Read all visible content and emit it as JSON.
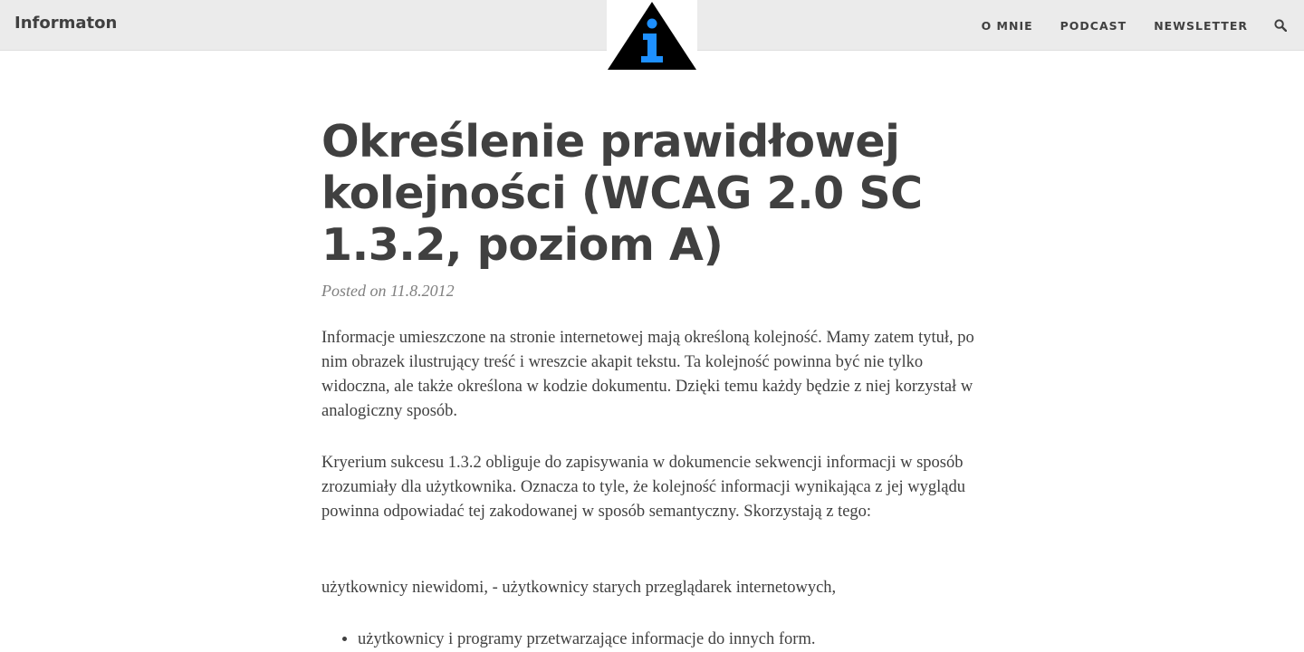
{
  "navbar": {
    "brand": "Informaton",
    "logo_icon": "info-triangle-logo",
    "links": [
      "O MNIE",
      "PODCAST",
      "NEWSLETTER"
    ],
    "search_icon": "search-icon"
  },
  "post": {
    "title": "Określenie prawidłowej kolejności (WCAG 2.0 SC 1.3.2, poziom A)",
    "meta": "Posted on 11.8.2012",
    "paragraphs": [
      "Informacje umieszczone na stronie internetowej mają określoną kolejność. Mamy zatem tytuł, po nim obrazek ilustrujący treść i wreszcie akapit tekstu. Ta kolejność powinna być nie tylko widoczna, ale także określona w kodzie dokumentu. Dzięki temu każdy będzie z niej korzystał w analogiczny sposób.",
      "Kryerium sukcesu 1.3.2 obliguje do zapisywania w dokumencie sekwencji informacji w sposób zrozumiały dla użytkownika. Oznacza to tyle, że kolejność informacji wynikająca z jej wyglądu powinna odpowiadać tej zakodowanej w sposób semantyczny. Skorzystają z tego:",
      "użytkownicy niewidomi, - użytkownicy starych przeglądarek internetowych,"
    ],
    "list_items": [
      "użytkownicy i programy przetwarzające informacje do innych form."
    ]
  },
  "colors": {
    "navbar_bg": "#ebebeb",
    "text": "#404040",
    "meta": "#808080",
    "logo_accent": "#1e90ff"
  }
}
